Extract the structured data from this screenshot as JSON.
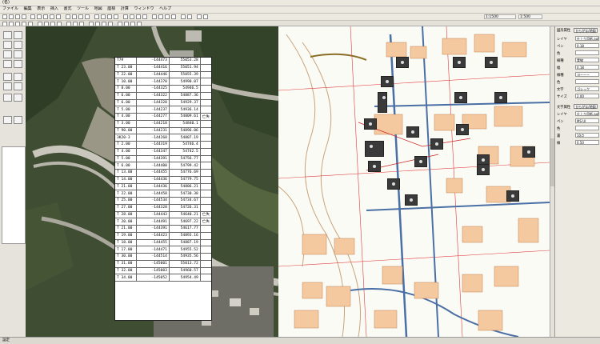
{
  "window": {
    "title": "(名)"
  },
  "menu": {
    "items": [
      "ファイル",
      "編集",
      "表示",
      "挿入",
      "書式",
      "ツール",
      "地図",
      "座標",
      "計算",
      "ウィンドウ",
      "ヘルプ"
    ]
  },
  "toolbar": {
    "scale_field": "1:1500",
    "zoom_field": "1:500"
  },
  "table": {
    "rows": [
      [
        "T7#",
        "-144473",
        "55053.28",
        ""
      ],
      [
        "T 23.00",
        "-144416",
        "55051.94",
        ""
      ],
      [
        "T 22.00",
        "-144446",
        "55055.39",
        ""
      ],
      [
        "T 10.00",
        "-144370",
        "54990.07",
        ""
      ],
      [
        "T 8.00",
        "-144325",
        "54946.5",
        ""
      ],
      [
        "T 6.00",
        "-144322",
        "54887.36",
        ""
      ],
      [
        "T 6.00",
        "-144320",
        "54929.37",
        ""
      ],
      [
        "T 5.00",
        "-144237",
        "54936.14",
        ""
      ],
      [
        "T 4.00",
        "-144277",
        "54809.61",
        "亡失"
      ],
      [
        "T 3.00",
        "-144218",
        "54840.1",
        ""
      ],
      [
        "T 90.00",
        "-144231",
        "54896.06",
        ""
      ],
      [
        "3K20-3",
        "-144268",
        "54807.19",
        ""
      ],
      [
        "T 2.00",
        "-144319",
        "54746.4",
        ""
      ],
      [
        "T 4.00",
        "-144347",
        "54742.5",
        ""
      ],
      [
        "T 5.00",
        "-144391",
        "54756.77",
        ""
      ],
      [
        "T 6.00",
        "-144400",
        "54799.42",
        ""
      ],
      [
        "T 13.00",
        "-144455",
        "54776.69",
        ""
      ],
      [
        "T 14.00",
        "-144436",
        "54779.75",
        ""
      ],
      [
        "T 21.00",
        "-144436",
        "54806.21",
        ""
      ],
      [
        "T 22.00",
        "-144458",
        "54730.38",
        ""
      ],
      [
        "T 25.00",
        "-144534",
        "54734.67",
        ""
      ],
      [
        "T 27.00",
        "-144328",
        "54726.31",
        ""
      ],
      [
        "T 28.00",
        "-144443",
        "54640.21",
        "亡失"
      ],
      [
        "T 20.00",
        "-144491",
        "54697.22",
        "亡失"
      ],
      [
        "T 21.00",
        "-144391",
        "54617.77",
        ""
      ],
      [
        "T 19.00",
        "-144423",
        "54893.16",
        ""
      ],
      [
        "T 18.00",
        "-144455",
        "54887.19",
        ""
      ],
      [
        "T 17.00",
        "-144471",
        "54955.52",
        ""
      ],
      [
        "T 30.00",
        "-144514",
        "54935.56",
        ""
      ],
      [
        "T 31.00",
        "-145001",
        "55013.72",
        ""
      ],
      [
        "T 32.00",
        "-145003",
        "54960.57",
        ""
      ],
      [
        "T 34.00",
        "-145052",
        "54954.49",
        ""
      ]
    ]
  },
  "right_panel": {
    "header_btn1": "ひらがな/地図",
    "header_btn2": "ひらがな/地図",
    "rows": [
      {
        "label": "レイヤ",
        "value": "仕上り用紙.autoe"
      },
      {
        "label": "ペン",
        "value": "0.18"
      },
      {
        "label": "色",
        "value": ""
      },
      {
        "label": "線種",
        "value": "実線"
      },
      {
        "label": "幅",
        "value": "0.18"
      },
      {
        "label": "線種",
        "value": "ヨーーー"
      },
      {
        "label": "色",
        "value": ""
      },
      {
        "label": "文字",
        "value": "ゴシック"
      },
      {
        "label": "サイズ",
        "value": "2.00"
      }
    ],
    "section2_title": "文字属性",
    "rows2": [
      {
        "label": "レイヤ",
        "value": "仕上り用紙.autoe"
      },
      {
        "label": "ペン",
        "value": "MS UI"
      },
      {
        "label": "色",
        "value": ""
      },
      {
        "label": "書",
        "value": "10点"
      },
      {
        "label": "線",
        "value": "0.50"
      }
    ]
  },
  "status": {
    "text": "設定"
  }
}
